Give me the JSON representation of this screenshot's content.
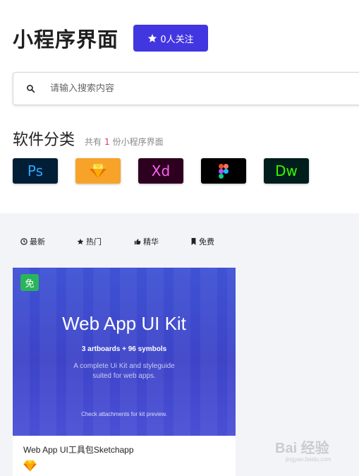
{
  "header": {
    "title": "小程序界面",
    "follow_label": "0人关注"
  },
  "search": {
    "placeholder": "请输入搜索内容"
  },
  "category": {
    "title": "软件分类",
    "count_prefix": "共有",
    "count": "1",
    "count_suffix": "份小程序界面"
  },
  "apps": [
    {
      "name": "Ps",
      "icon": "photoshop-icon"
    },
    {
      "name": "",
      "icon": "sketch-icon"
    },
    {
      "name": "Xd",
      "icon": "xd-icon"
    },
    {
      "name": "",
      "icon": "figma-icon"
    },
    {
      "name": "Dw",
      "icon": "dreamweaver-icon"
    }
  ],
  "filters": [
    {
      "label": "最新",
      "icon": "clock-icon"
    },
    {
      "label": "热门",
      "icon": "star-icon"
    },
    {
      "label": "精华",
      "icon": "thumbs-up-icon"
    },
    {
      "label": "免费",
      "icon": "bookmark-icon"
    }
  ],
  "card": {
    "badge": "免",
    "thumb_title": "Web App UI Kit",
    "thumb_sub": "3 artboards + 96 symbols",
    "thumb_desc_1": "A complete Ui Kit and styleguide",
    "thumb_desc_2": "suited for web apps.",
    "thumb_note": "Check attachments for kit preview.",
    "title": "Web App UI工具包Sketchapp"
  },
  "watermark": {
    "text": "Bai 经验",
    "sub": "jingyan.baidu.com"
  },
  "colors": {
    "accent": "#4236e0",
    "count_highlight": "#e0306b",
    "badge_green": "#29b45c"
  }
}
